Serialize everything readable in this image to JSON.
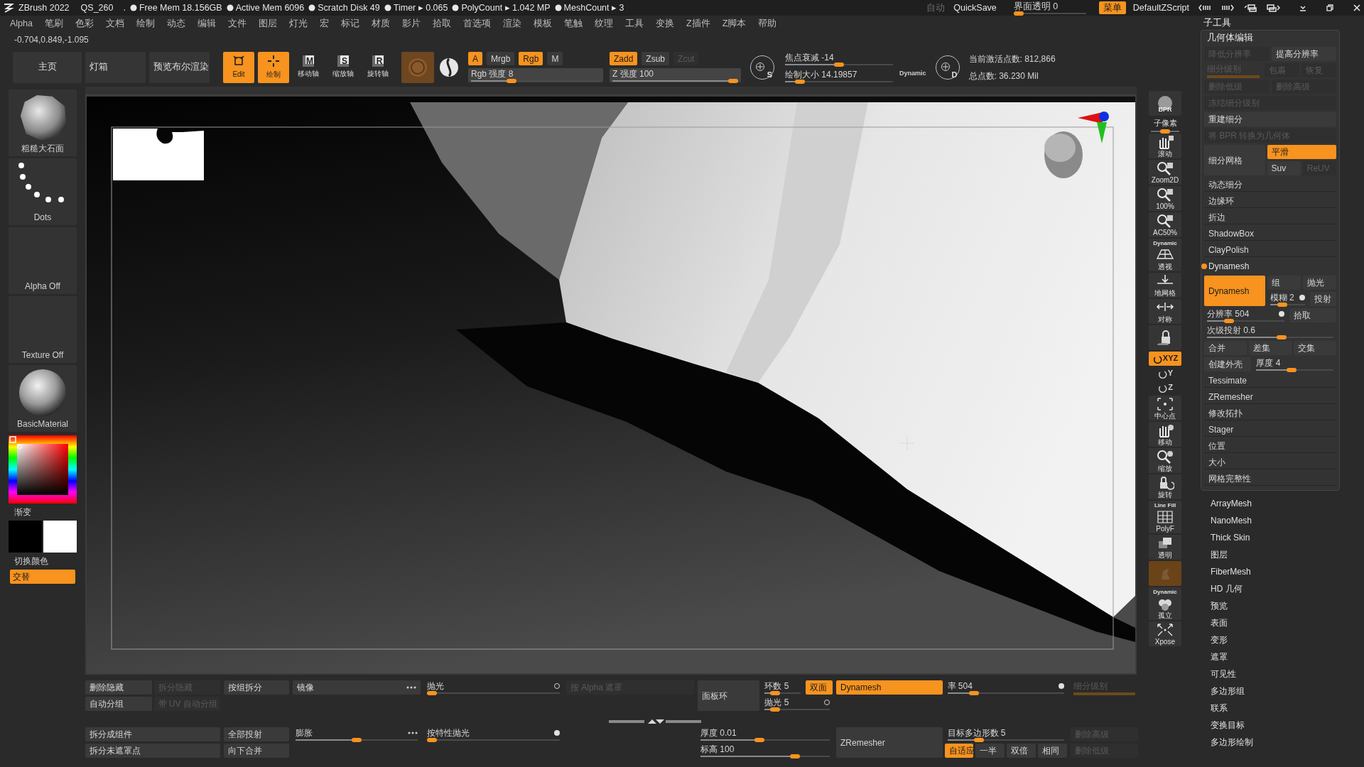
{
  "title_bar": {
    "app": "ZBrush 2022",
    "file": "QS_260",
    "separator": ".",
    "stats": [
      "Free Mem 18.156GB",
      "Active Mem 6096",
      "Scratch Disk 49",
      "Timer ▸ 0.065",
      "PolyCount ▸ 1.042 MP",
      "MeshCount ▸ 3"
    ],
    "auto": {
      "label": "自动",
      "disabled": true
    },
    "quicksave": "QuickSave",
    "transparency": {
      "label": "界面透明 0",
      "level": 0
    },
    "menu_button": {
      "label": "菜单",
      "active": true
    },
    "script": "DefaultZScript"
  },
  "menu_bar": [
    "Alpha",
    "笔刷",
    "色彩",
    "文档",
    "绘制",
    "动态",
    "编辑",
    "文件",
    "图层",
    "灯光",
    "宏",
    "标记",
    "材质",
    "影片",
    "拾取",
    "首选项",
    "渲染",
    "模板",
    "笔触",
    "纹理",
    "工具",
    "变换",
    "Z插件",
    "Z脚本",
    "帮助"
  ],
  "coordinates": "-0.704,0.849,-1.095",
  "shelf": {
    "pages": [
      "主页",
      "灯箱",
      "预览布尔渲染"
    ],
    "modes": [
      {
        "label": "Edit",
        "active": true
      },
      {
        "label": "绘制",
        "active": true
      },
      {
        "label": "移动轴",
        "glyph": "M",
        "active": false
      },
      {
        "label": "缩放轴",
        "glyph": "S",
        "active": false
      },
      {
        "label": "旋转轴",
        "glyph": "R",
        "active": false
      }
    ],
    "rgb": [
      {
        "kind": "button",
        "label": "A",
        "active": true,
        "disabled": false
      },
      {
        "kind": "button",
        "label": "Mrgb",
        "active": false,
        "disabled": false
      },
      {
        "kind": "button",
        "label": "Rgb",
        "active": true,
        "disabled": false
      },
      {
        "kind": "button",
        "label": "M",
        "active": false,
        "disabled": false
      }
    ],
    "rgb_intensity": {
      "label": "Rgb 强度 8",
      "level": 0.3
    },
    "z": [
      {
        "kind": "button",
        "label": "Zadd",
        "active": true,
        "disabled": false
      },
      {
        "kind": "button",
        "label": "Zsub",
        "active": false,
        "disabled": false
      },
      {
        "kind": "button",
        "label": "Zcut",
        "active": false,
        "disabled": true
      }
    ],
    "z_intensity": {
      "label": "Z 强度 100",
      "level": 1
    },
    "lazy_s": "S",
    "focal_shift": {
      "label": "焦点衰减 -14",
      "level": 0.5
    },
    "draw_size": {
      "label": "绘制大小 14.19857",
      "level": 0.1
    },
    "dynamic": "Dynamic",
    "lazy_d": "D",
    "active_points": "当前激活点数: 812,866",
    "total_points": "总点数: 36.230 Mil"
  },
  "left_tray": {
    "brush": "粗糙大石面",
    "stroke": "Dots",
    "alpha": "Alpha Off",
    "texture": "Texture Off",
    "material": "BasicMaterial",
    "gradient": "渐变",
    "swatches": [
      {
        "color": "#000000"
      },
      {
        "color": "#ffffff"
      }
    ],
    "swap": "切换颜色",
    "alternate": {
      "label": "交替",
      "active": true
    }
  },
  "toolbar": [
    {
      "label": "BPR",
      "active": false
    },
    {
      "label": "子像素",
      "level": 0.5
    },
    {
      "label": "滚动",
      "active": false
    },
    {
      "label": "Zoom2D",
      "active": false
    },
    {
      "label": "100%",
      "active": false
    },
    {
      "label": "AC50%",
      "active": false
    },
    {
      "caption": "Dynamic",
      "label": "透视",
      "active": false
    },
    {
      "label": "地网格",
      "active": false
    },
    {
      "label": "对称",
      "active": false
    },
    {
      "active": false
    },
    {
      "label": "XYZ",
      "active": true
    },
    {
      "label": "Y",
      "active": false
    },
    {
      "label": "Z",
      "active": false
    },
    {
      "label": "中心点",
      "active": false
    },
    {
      "label": "移动",
      "active": false
    },
    {
      "label": "缩放",
      "active": false
    },
    {
      "label": "旋转",
      "active": false
    },
    {
      "caption": "Line Fill",
      "label": "PolyF",
      "active": false
    },
    {
      "label": "透明",
      "active": false
    },
    {
      "active": true,
      "disabled": true
    },
    {
      "caption": "Dynamic",
      "label": "孤立",
      "active": false
    },
    {
      "label": "Xpose",
      "active": false
    }
  ],
  "bottom_panel": [
    {
      "top": [
        {
          "kind": "row",
          "controls": [
            {
              "kind": "button",
              "label": "删除隐藏",
              "active": false,
              "disabled": false
            },
            {
              "kind": "button",
              "label": "拆分隐藏",
              "active": false,
              "disabled": true
            }
          ]
        },
        {
          "kind": "row",
          "controls": [
            {
              "kind": "button",
              "label": "自动分组",
              "active": false,
              "disabled": false
            },
            {
              "kind": "button",
              "label": "带 UV 自动分组",
              "active": false,
              "disabled": true
            }
          ]
        }
      ],
      "bottom": [
        {
          "kind": "row",
          "controls": [
            {
              "kind": "button",
              "label": "拆分成组件",
              "active": false,
              "disabled": false
            }
          ]
        },
        {
          "kind": "row",
          "controls": [
            {
              "kind": "button",
              "label": "拆分未遮罩点",
              "active": false,
              "disabled": false
            }
          ]
        }
      ]
    },
    {
      "top": [
        {
          "kind": "row",
          "controls": [
            {
              "kind": "button",
              "label": "按组拆分",
              "active": false,
              "disabled": false
            }
          ]
        }
      ],
      "bottom": [
        {
          "kind": "row",
          "controls": [
            {
              "kind": "button",
              "label": "全部投射",
              "active": false,
              "disabled": false
            }
          ]
        },
        {
          "kind": "row",
          "controls": [
            {
              "kind": "button",
              "label": "向下合并",
              "active": false,
              "disabled": false
            }
          ]
        }
      ]
    },
    {
      "top": [
        {
          "kind": "row",
          "controls": [
            {
              "kind": "button",
              "label": "镜像",
              "active": false,
              "disabled": false,
              "axes": true
            }
          ]
        }
      ],
      "bottom": [
        {
          "kind": "row",
          "controls": [
            {
              "kind": "slider",
              "label": "膨胀",
              "level": 0.5,
              "axes": true
            }
          ]
        }
      ]
    },
    {
      "top": [
        {
          "kind": "row",
          "controls": [
            {
              "kind": "slider",
              "label": "抛光",
              "level": 0,
              "on": false
            }
          ]
        }
      ],
      "bottom": [
        {
          "kind": "row",
          "controls": [
            {
              "kind": "slider",
              "label": "按特性抛光",
              "level": 0,
              "on": true
            }
          ]
        }
      ]
    },
    {
      "top": [
        {
          "kind": "row",
          "controls": [
            {
              "kind": "button",
              "label": "按 Alpha 遮罩",
              "active": false,
              "disabled": true
            }
          ]
        }
      ],
      "bottom": [
        {
          "kind": "arrows"
        }
      ]
    },
    {
      "top": [
        {
          "kind": "block",
          "main": {
            "kind": "button",
            "label": "面板环",
            "active": false,
            "disabled": false
          },
          "options": [
            [
              {
                "kind": "slider",
                "label": "环数 5",
                "level": 0.2
              },
              {
                "kind": "button",
                "label": "双面",
                "active": true,
                "disabled": false
              }
            ],
            [
              {
                "kind": "slider",
                "label": "抛光 5",
                "level": 0.1,
                "on": false
              }
            ]
          ]
        }
      ],
      "bottom": [
        {
          "kind": "row",
          "controls": [
            {
              "kind": "slider",
              "label": "厚度 0.01",
              "level": 0.45
            }
          ]
        },
        {
          "kind": "row",
          "controls": [
            {
              "kind": "slider",
              "label": "标高 100",
              "level": 0.75
            }
          ]
        }
      ]
    },
    {
      "top": [
        {
          "kind": "block",
          "main": {
            "kind": "button",
            "label": "Dynamesh",
            "active": true,
            "disabled": false
          },
          "options": [
            [
              {
                "kind": "slider",
                "label": "率 504",
                "level": 0.2,
                "on": true
              }
            ]
          ]
        }
      ],
      "bottom": [
        {
          "kind": "block",
          "main": {
            "kind": "button",
            "label": "ZRemesher",
            "active": false,
            "disabled": false
          },
          "options": [
            [
              {
                "kind": "slider",
                "label": "目标多边形数 5",
                "level": 0.25
              }
            ],
            [
              {
                "kind": "button",
                "label": "自适应",
                "active": true,
                "disabled": false
              },
              {
                "kind": "button",
                "label": "一半",
                "active": false,
                "disabled": false
              },
              {
                "kind": "button",
                "label": "双倍",
                "active": false,
                "disabled": false
              },
              {
                "kind": "button",
                "label": "相同",
                "active": false,
                "disabled": false
              }
            ]
          ]
        }
      ]
    },
    {
      "top": [
        {
          "kind": "row",
          "controls": [
            {
              "kind": "slider",
              "label": "细分级别",
              "level": 1,
              "disabled": true
            }
          ]
        }
      ],
      "bottom": [
        {
          "kind": "row",
          "controls": [
            {
              "kind": "button",
              "label": "删除高级",
              "active": false,
              "disabled": true
            }
          ]
        },
        {
          "kind": "row",
          "controls": [
            {
              "kind": "button",
              "label": "删除低级",
              "active": false,
              "disabled": true
            }
          ]
        }
      ]
    }
  ],
  "right_panel": {
    "title": "子工具",
    "section": "几何体编辑",
    "items": [
      {
        "kind": "row",
        "controls": [
          {
            "kind": "button",
            "label": "降低分辨率",
            "active": false,
            "disabled": true
          },
          {
            "kind": "button",
            "label": "提高分辨率",
            "active": false,
            "disabled": false
          }
        ]
      },
      {
        "kind": "row",
        "controls": [
          {
            "kind": "slider",
            "label": "细分级别",
            "level": 1,
            "disabled": true
          },
          {
            "kind": "button",
            "label": "包裹",
            "active": false,
            "disabled": true
          },
          {
            "kind": "button",
            "label": "恢复",
            "active": false,
            "disabled": true
          }
        ]
      },
      {
        "kind": "row",
        "controls": [
          {
            "kind": "button",
            "label": "删除低级",
            "active": false,
            "disabled": true
          },
          {
            "kind": "button",
            "label": "删除高级",
            "active": false,
            "disabled": true
          }
        ]
      },
      {
        "kind": "row",
        "controls": [
          {
            "kind": "button",
            "label": "冻结细分级别",
            "active": false,
            "disabled": true
          }
        ]
      },
      {
        "kind": "row",
        "controls": [
          {
            "kind": "button",
            "label": "重建细分",
            "active": false,
            "disabled": false
          }
        ]
      },
      {
        "kind": "row",
        "controls": [
          {
            "kind": "button",
            "label": "将 BPR 转换为几何体",
            "active": false,
            "disabled": true
          }
        ]
      },
      {
        "kind": "block",
        "main": {
          "kind": "button",
          "label": "细分网格",
          "active": false,
          "disabled": false
        },
        "options": [
          [
            {
              "kind": "button",
              "label": "平滑",
              "active": true,
              "disabled": false
            }
          ],
          [
            {
              "kind": "button",
              "label": "Suv",
              "active": false,
              "disabled": false
            },
            {
              "kind": "button",
              "label": "ReUV",
              "active": false,
              "disabled": true
            }
          ]
        ]
      },
      {
        "kind": "header",
        "label": "动态细分"
      },
      {
        "kind": "header",
        "label": "边缘环"
      },
      {
        "kind": "header",
        "label": "折边"
      },
      {
        "kind": "header",
        "label": "ShadowBox"
      },
      {
        "kind": "header",
        "label": "ClayPolish"
      },
      {
        "kind": "toggle_header",
        "label": "Dynamesh",
        "on": true
      },
      {
        "kind": "block",
        "main": {
          "kind": "button",
          "label": "Dynamesh",
          "active": true,
          "disabled": false
        },
        "options": [
          [
            {
              "kind": "button",
              "label": "组",
              "active": false,
              "disabled": false
            },
            {
              "kind": "button",
              "label": "抛光",
              "active": false,
              "disabled": false
            }
          ],
          [
            {
              "kind": "slider",
              "label": "模糊 2",
              "level": 0.3,
              "on": true
            },
            {
              "kind": "button",
              "label": "投射",
              "active": false,
              "disabled": false
            }
          ]
        ]
      },
      {
        "kind": "row",
        "controls": [
          {
            "kind": "slider",
            "label": "分辨率 504",
            "level": 0.25,
            "on": true
          },
          {
            "kind": "button",
            "label": "拾取",
            "active": false,
            "disabled": false
          }
        ]
      },
      {
        "kind": "row",
        "controls": [
          {
            "kind": "slider",
            "label": "次级投射 0.6",
            "level": 0.6
          }
        ]
      },
      {
        "kind": "row",
        "controls": [
          {
            "kind": "button",
            "label": "合并",
            "active": false,
            "disabled": false
          },
          {
            "kind": "button",
            "label": "差集",
            "active": false,
            "disabled": false
          },
          {
            "kind": "button",
            "label": "交集",
            "active": false,
            "disabled": false
          }
        ]
      },
      {
        "kind": "row",
        "controls": [
          {
            "kind": "button",
            "label": "创建外壳",
            "active": false,
            "disabled": false
          },
          {
            "kind": "slider",
            "label": "厚度 4",
            "level": 0.45
          }
        ]
      },
      {
        "kind": "header",
        "label": "Tessimate"
      },
      {
        "kind": "header",
        "label": "ZRemesher"
      },
      {
        "kind": "header",
        "label": "修改拓扑"
      },
      {
        "kind": "header",
        "label": "Stager"
      },
      {
        "kind": "header",
        "label": "位置"
      },
      {
        "kind": "header",
        "label": "大小"
      },
      {
        "kind": "header",
        "label": "网格完整性"
      }
    ],
    "palettes": [
      "ArrayMesh",
      "NanoMesh",
      "Thick Skin",
      "图层",
      "FiberMesh",
      "HD 几何",
      "预览",
      "表面",
      "变形",
      "遮罩",
      "可见性",
      "多边形组",
      "联系",
      "变换目标",
      "多边形绘制"
    ]
  }
}
